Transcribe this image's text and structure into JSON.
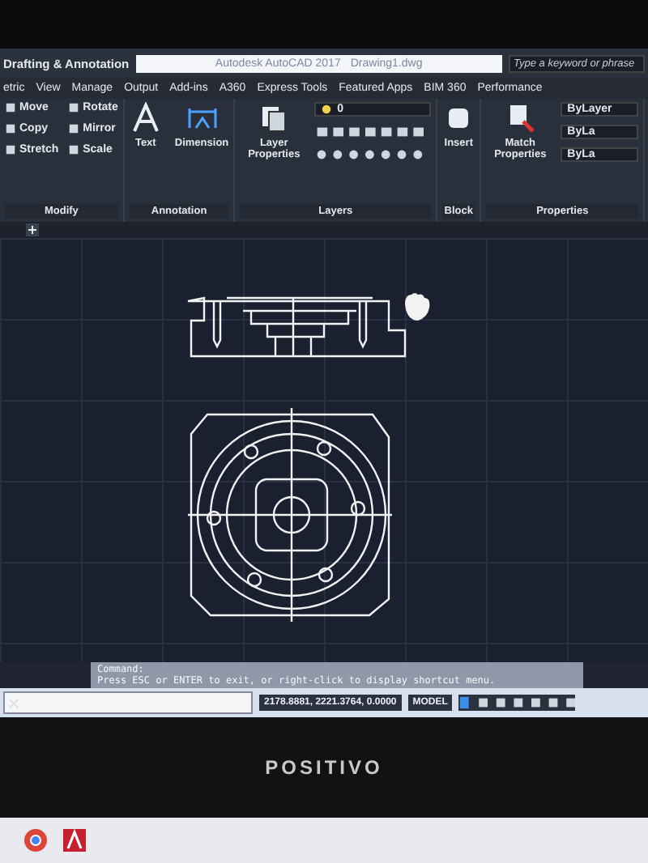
{
  "title_bar": {
    "workspace": "Drafting & Annotation",
    "title": "Autodesk AutoCAD 2017",
    "file": "Drawing1.dwg",
    "search": {
      "placeholder": "Type a keyword or phrase"
    }
  },
  "tabs": [
    {
      "label": "etric",
      "selected": false
    },
    {
      "label": "View",
      "selected": false
    },
    {
      "label": "Manage",
      "selected": false
    },
    {
      "label": "Output",
      "selected": false
    },
    {
      "label": "Add-ins",
      "selected": false
    },
    {
      "label": "A360",
      "selected": false
    },
    {
      "label": "Express Tools",
      "selected": false
    },
    {
      "label": "Featured Apps",
      "selected": false
    },
    {
      "label": "BIM 360",
      "selected": false
    },
    {
      "label": "Performance",
      "selected": false
    }
  ],
  "panels": [
    {
      "kind": "modify",
      "title": "Modify",
      "items": [
        "Move",
        "Rotate",
        "Copy",
        "Mirror",
        "Stretch",
        "Scale"
      ]
    },
    {
      "kind": "annotation",
      "title": "Annotation",
      "items": [
        "Text",
        "Dimension"
      ]
    },
    {
      "kind": "layers",
      "title": "Layers",
      "items": [
        "Layer Properties",
        "0"
      ]
    },
    {
      "kind": "block",
      "title": "Block",
      "items": [
        "Insert"
      ]
    },
    {
      "kind": "properties",
      "title": "Properties",
      "items": [
        "Match Properties",
        "ByLayer",
        "ByLa",
        "ByLa"
      ]
    }
  ],
  "command": {
    "label": "Command:",
    "message": "Press ESC or ENTER to exit, or right-click to display shortcut menu."
  },
  "status_bar": {
    "coordinates": "2178.8881, 2221.3764, 0.0000",
    "mode": "MODEL"
  },
  "monitor": {
    "brand": "POSITIVO"
  }
}
